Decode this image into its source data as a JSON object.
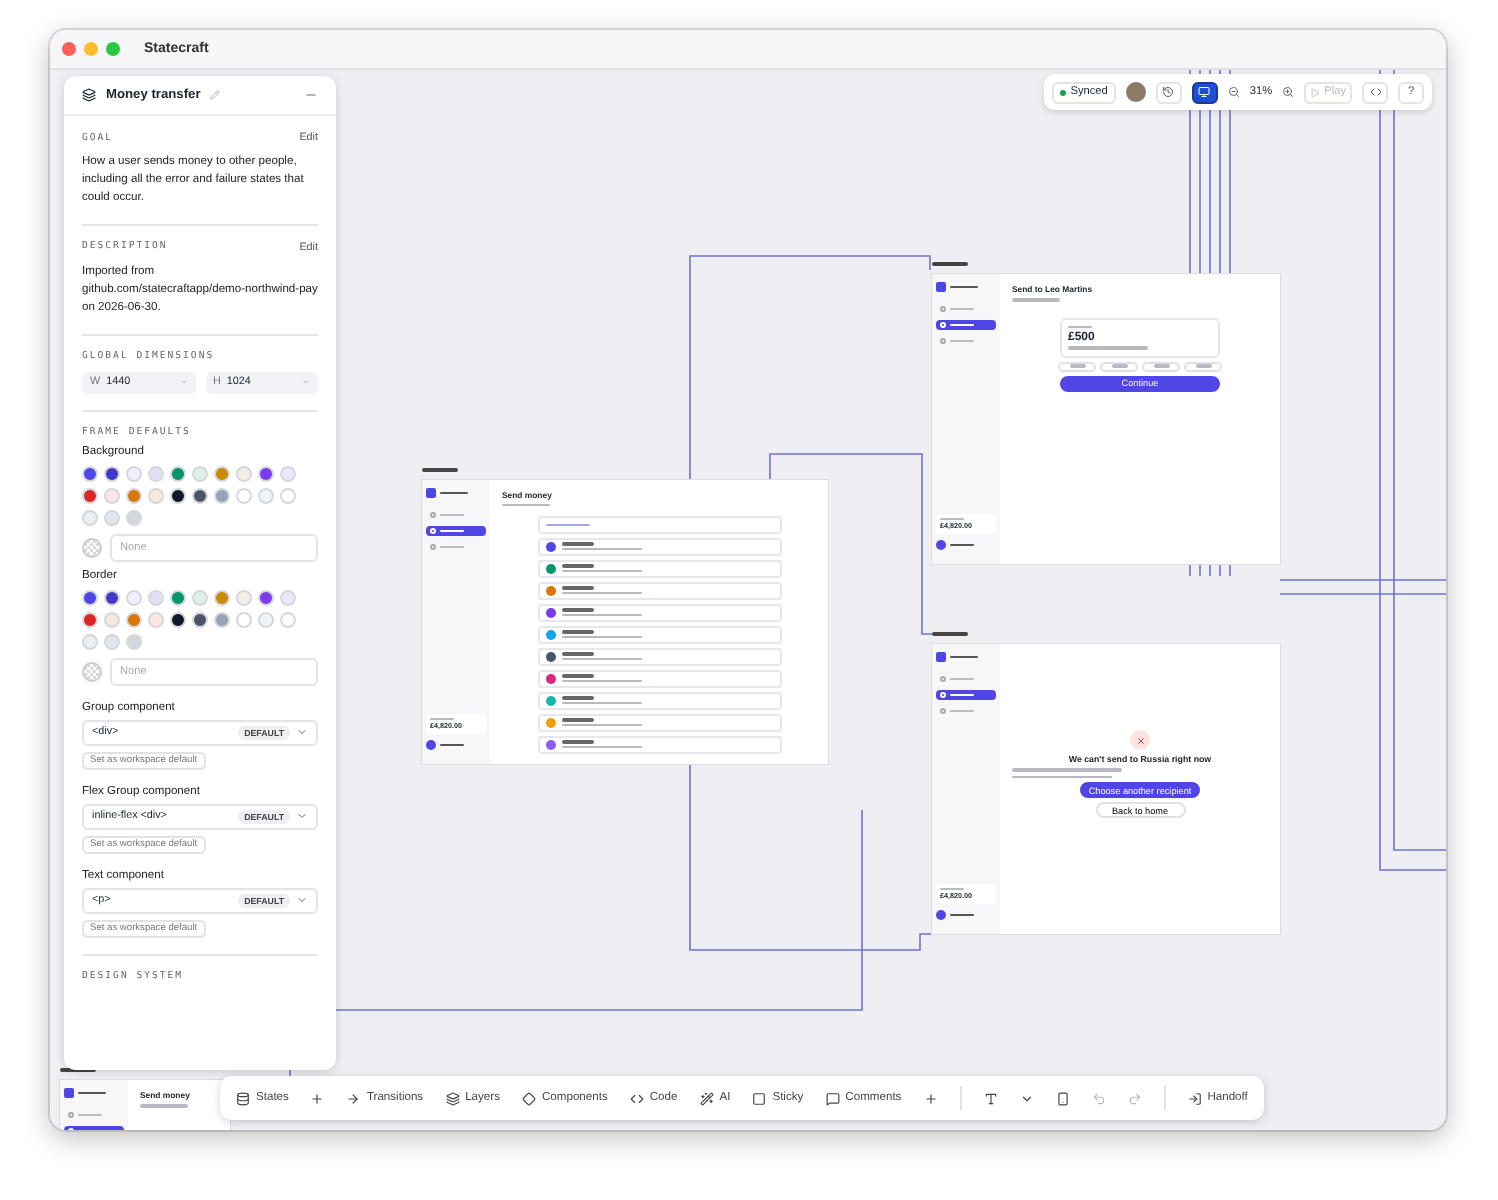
{
  "window": {
    "title": "Statecraft"
  },
  "panel": {
    "title": "Money transfer",
    "goal": {
      "heading": "GOAL",
      "action": "Edit",
      "text": "How a user sends money to other people, including all the error and failure states that could occur."
    },
    "description": {
      "heading": "DESCRIPTION",
      "action": "Edit",
      "text": "Imported from github.com/statecraftapp/demo-northwind-pay on 2026-06-30."
    },
    "dimensions": {
      "heading": "GLOBAL DIMENSIONS",
      "fields": [
        {
          "label": "W",
          "value": "1440"
        },
        {
          "label": "H",
          "value": "1024"
        }
      ]
    },
    "frame_defaults": {
      "heading": "FRAME DEFAULTS",
      "pickers": [
        {
          "label": "Background",
          "placeholder": "None",
          "swatches": [
            {
              "color": "#4f46e5"
            },
            {
              "color": "#4338ca"
            },
            {
              "color": "#eef0fc"
            },
            {
              "color": "#e0e1f7"
            },
            {
              "color": "#059669"
            },
            {
              "color": "#dcefe7"
            },
            {
              "color": "#ca8a04"
            },
            {
              "color": "#f5efe3"
            },
            {
              "color": "#7c3aed"
            },
            {
              "color": "#ede5fb"
            },
            {
              "color": "#dc2626"
            },
            {
              "color": "#fde4e4"
            },
            {
              "color": "#d97706"
            },
            {
              "color": "#f9e9dd"
            },
            {
              "color": "#111827"
            },
            {
              "color": "#4b5563"
            },
            {
              "color": "#94a3b8"
            },
            {
              "color": "#ffffff"
            },
            {
              "color": "#f1f2f6"
            },
            {
              "color": "#fefefe"
            },
            {
              "color": "#eceef2"
            },
            {
              "color": "#e2e4ea"
            },
            {
              "color": "#d1d5dc"
            }
          ]
        },
        {
          "label": "Border",
          "placeholder": "None",
          "swatches": [
            {
              "color": "#4f46e5"
            },
            {
              "color": "#4338ca"
            },
            {
              "color": "#eef0fc"
            },
            {
              "color": "#e0e1f7"
            },
            {
              "color": "#059669"
            },
            {
              "color": "#dcefe7"
            },
            {
              "color": "#ca8a04"
            },
            {
              "color": "#f5efe3"
            },
            {
              "color": "#7c3aed"
            },
            {
              "color": "#ede5fb"
            },
            {
              "color": "#dc2626"
            },
            {
              "color": "#fde4e4"
            },
            {
              "color": "#d97706"
            },
            {
              "color": "#f9e9dd"
            },
            {
              "color": "#111827"
            },
            {
              "color": "#4b5563"
            },
            {
              "color": "#94a3b8"
            },
            {
              "color": "#ffffff"
            },
            {
              "color": "#f1f2f6"
            },
            {
              "color": "#fefefe"
            },
            {
              "color": "#eceef2"
            },
            {
              "color": "#e2e4ea"
            },
            {
              "color": "#d1d5dc"
            }
          ]
        }
      ]
    },
    "components": [
      {
        "label": "Group component",
        "value": "<div>",
        "badge": "DEFAULT",
        "button": "Set as workspace default"
      },
      {
        "label": "Flex Group component",
        "value": "inline-flex <div>",
        "badge": "DEFAULT",
        "button": "Set as workspace default"
      },
      {
        "label": "Text component",
        "value": "<p>",
        "badge": "DEFAULT",
        "button": "Set as workspace default"
      }
    ],
    "design_system": {
      "heading": "DESIGN SYSTEM"
    }
  },
  "top_toolbar": {
    "sync_status": "Synced",
    "present": {
      "selected": true
    },
    "zoom": "31%",
    "play": {
      "label": "Play",
      "disabled": true
    },
    "help": "?"
  },
  "bottom_toolbar": {
    "tools": [
      {
        "kind": "states",
        "label": "States"
      },
      {
        "kind": "add"
      },
      {
        "kind": "transitions",
        "label": "Transitions"
      },
      {
        "kind": "layers",
        "label": "Layers"
      },
      {
        "kind": "components",
        "label": "Components"
      },
      {
        "kind": "code",
        "label": "Code"
      },
      {
        "kind": "ai",
        "label": "AI"
      },
      {
        "kind": "sticky",
        "label": "Sticky"
      },
      {
        "kind": "comments",
        "label": "Comments"
      },
      {
        "kind": "add"
      },
      {
        "kind": "divider"
      },
      {
        "kind": "text"
      },
      {
        "kind": "dropdown"
      },
      {
        "kind": "device"
      },
      {
        "kind": "undo"
      },
      {
        "kind": "redo"
      },
      {
        "kind": "divider"
      },
      {
        "kind": "handoff",
        "label": "Handoff"
      }
    ]
  },
  "canvas": {
    "frames": [
      {
        "kind": "contacts",
        "title": "Send money",
        "balance": "£4,820.00",
        "nav": [
          {
            "selected": false
          },
          {
            "selected": true
          },
          {
            "selected": false
          }
        ],
        "contacts": [
          {
            "color": "#4f46e5"
          },
          {
            "color": "#059669"
          },
          {
            "color": "#d97706"
          },
          {
            "color": "#7c3aed"
          },
          {
            "color": "#0ea5e9"
          },
          {
            "color": "#475569"
          },
          {
            "color": "#db2777"
          },
          {
            "color": "#14b8a6"
          },
          {
            "color": "#f59e0b"
          },
          {
            "color": "#8b5cf6"
          }
        ]
      },
      {
        "kind": "amount",
        "title": "Send to Leo Martins",
        "balance": "£4,820.00",
        "nav": [
          {
            "selected": false
          },
          {
            "selected": true
          },
          {
            "selected": false
          }
        ],
        "amount": "£500",
        "button": "Continue"
      },
      {
        "kind": "error",
        "title": "We can't send to Russia right now",
        "balance": "£4,820.00",
        "nav": [
          {
            "selected": false
          },
          {
            "selected": true
          },
          {
            "selected": false
          }
        ],
        "primary_button": "Choose another recipient",
        "secondary_button": "Back to home"
      },
      {
        "kind": "contacts",
        "title": "Send money",
        "nav": [
          {
            "selected": false
          },
          {
            "selected": true
          }
        ]
      }
    ]
  }
}
